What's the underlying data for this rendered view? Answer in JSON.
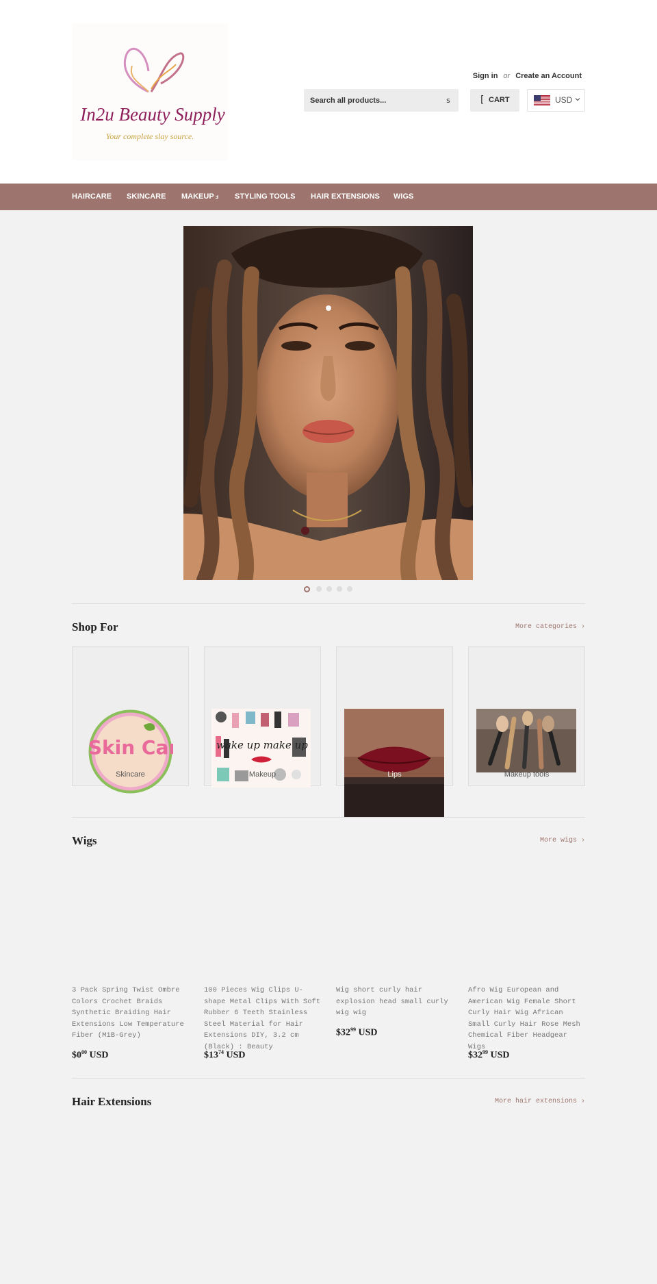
{
  "colors": {
    "accent": "#9e756e",
    "background": "#f2f2f2",
    "header": "#ffffff"
  },
  "header": {
    "logo": {
      "title": "In2u Beauty Supply",
      "tagline": "Your complete slay source."
    },
    "account": {
      "sign_in": "Sign in",
      "or": "or",
      "create": "Create an Account"
    },
    "search": {
      "placeholder": "Search all products...",
      "button_icon": "s"
    },
    "cart": {
      "icon": "[",
      "label": "CART"
    },
    "currency": {
      "label": "USD",
      "flag_icon": "us-flag-icon"
    }
  },
  "nav": {
    "items": [
      {
        "label": "HAIRCARE"
      },
      {
        "label": "SKINCARE"
      },
      {
        "label": "MAKEUP",
        "dropdown": "ⅎ"
      },
      {
        "label": "STYLING TOOLS"
      },
      {
        "label": "HAIR EXTENSIONS"
      },
      {
        "label": "WIGS"
      }
    ]
  },
  "slideshow": {
    "slides": 5,
    "active": 1
  },
  "shop_for": {
    "title": "Shop For",
    "more": "More categories ›",
    "categories": [
      {
        "label": "Skincare",
        "image_text": "Skin Care"
      },
      {
        "label": "Makeup",
        "image_text": "wake up make up"
      },
      {
        "label": "Lips"
      },
      {
        "label": "Makeup tools"
      }
    ]
  },
  "wigs": {
    "title": "Wigs",
    "more": "More wigs ›",
    "products": [
      {
        "name": "3 Pack Spring Twist Ombre Colors Crochet Braids Synthetic Braiding Hair Extensions Low Temperature Fiber (M1B-Grey)",
        "price_main": "$0",
        "price_cents": "00",
        "currency": "USD"
      },
      {
        "name": "100 Pieces Wig Clips U-shape Metal Clips With Soft Rubber 6 Teeth Stainless Steel Material for Hair Extensions DIY, 3.2 cm (Black) : Beauty",
        "price_main": "$13",
        "price_cents": "74",
        "currency": "USD"
      },
      {
        "name": "Wig short curly hair explosion head small curly wig wig",
        "price_main": "$32",
        "price_cents": "99",
        "currency": "USD"
      },
      {
        "name": "Afro Wig European and American Wig Female Short Curly Hair Wig African Small Curly Hair Rose Mesh Chemical Fiber Headgear Wigs",
        "price_main": "$32",
        "price_cents": "99",
        "currency": "USD"
      }
    ]
  },
  "hair_extensions": {
    "title": "Hair Extensions",
    "more": "More hair extensions ›"
  }
}
